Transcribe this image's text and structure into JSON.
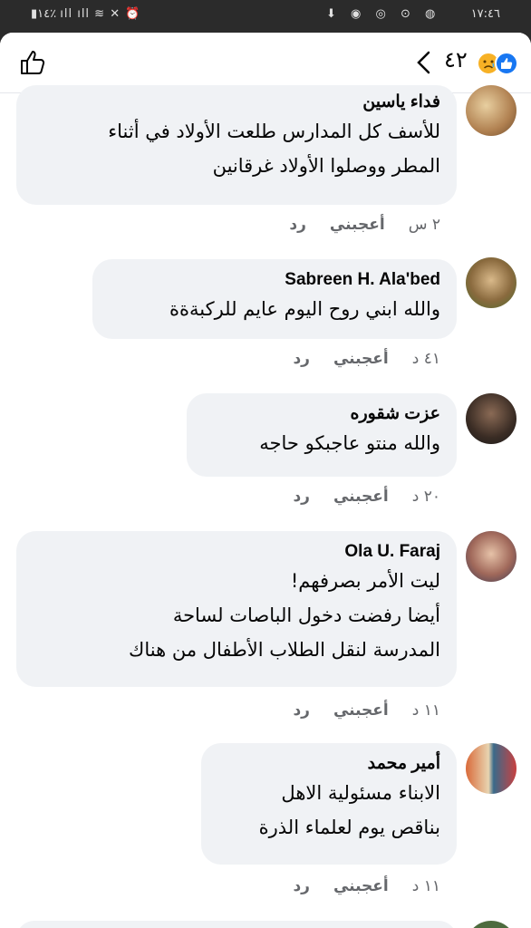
{
  "status_bar": {
    "time": "١٧:٤٦",
    "battery": "١٤٪"
  },
  "header": {
    "reaction_count": "٤٢",
    "reactions": [
      "sad",
      "like"
    ],
    "colors": {
      "like": "#1877f2",
      "sad": "#f7b125"
    }
  },
  "comments": [
    {
      "author": "فداء ياسين",
      "lines": [
        "للأسف كل المدارس طلعت الأولاد في أثناء",
        "المطر ووصلوا الأولاد غرقانين"
      ],
      "time": "٢ س",
      "like_label": "أعجبني",
      "reply_label": "رد"
    },
    {
      "author": "Sabreen H. Ala'bed",
      "lines": [
        "والله ابني روح اليوم عايم للركبةةة"
      ],
      "time": "٤١ د",
      "like_label": "أعجبني",
      "reply_label": "رد"
    },
    {
      "author": "عزت شقوره",
      "lines": [
        "والله منتو عاجبكو حاجه"
      ],
      "time": "٢٠ د",
      "like_label": "أعجبني",
      "reply_label": "رد"
    },
    {
      "author": "Ola U. Faraj",
      "lines": [
        "ليت الأمر بصرفهم!",
        "أيضا رفضت دخول الباصات لساحة",
        "المدرسة لنقل الطلاب الأطفال من هناك"
      ],
      "time": "١١ د",
      "like_label": "أعجبني",
      "reply_label": "رد"
    },
    {
      "author": "أمير محمد",
      "lines": [
        "الابناء مسئولية الاهل",
        "بناقص يوم لعلماء الذرة"
      ],
      "time": "١١ د",
      "like_label": "أعجبني",
      "reply_label": "رد"
    }
  ]
}
